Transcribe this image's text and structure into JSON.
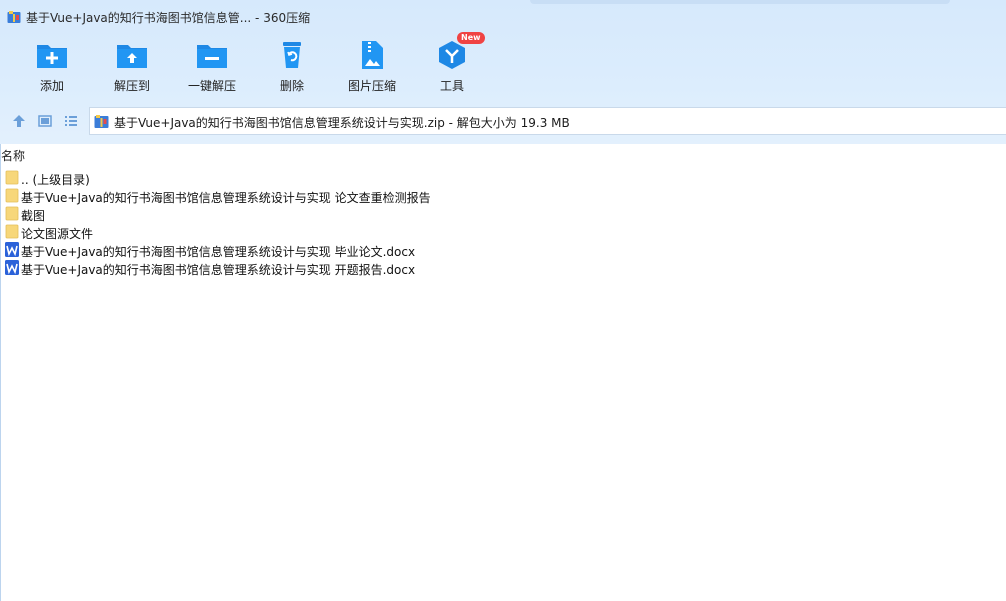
{
  "window": {
    "title": "基于Vue+Java的知行书海图书馆信息管... - 360压缩"
  },
  "toolbar": {
    "buttons": [
      {
        "label": "添加",
        "icon": "add-folder-icon"
      },
      {
        "label": "解压到",
        "icon": "extract-to-icon"
      },
      {
        "label": "一键解压",
        "icon": "one-click-extract-icon"
      },
      {
        "label": "删除",
        "icon": "recycle-bin-icon"
      },
      {
        "label": "图片压缩",
        "icon": "image-compress-icon"
      },
      {
        "label": "工具",
        "icon": "tools-icon",
        "badge": "New"
      }
    ]
  },
  "address": {
    "path": "基于Vue+Java的知行书海图书馆信息管理系统设计与实现.zip - 解包大小为 19.3 MB"
  },
  "list": {
    "header": "名称",
    "items": [
      {
        "name": ".. (上级目录)",
        "type": "folder"
      },
      {
        "name": "基于Vue+Java的知行书海图书馆信息管理系统设计与实现 论文查重检测报告",
        "type": "folder"
      },
      {
        "name": "截图",
        "type": "folder"
      },
      {
        "name": "论文图源文件",
        "type": "folder"
      },
      {
        "name": "基于Vue+Java的知行书海图书馆信息管理系统设计与实现 毕业论文.docx",
        "type": "word"
      },
      {
        "name": "基于Vue+Java的知行书海图书馆信息管理系统设计与实现 开题报告.docx",
        "type": "word"
      }
    ]
  },
  "colors": {
    "accent": "#1e88e5",
    "toolbar_bg": "#d6e9fc",
    "folder": "#f7d77a",
    "word": "#2b62d9",
    "badge": "#f04343"
  }
}
